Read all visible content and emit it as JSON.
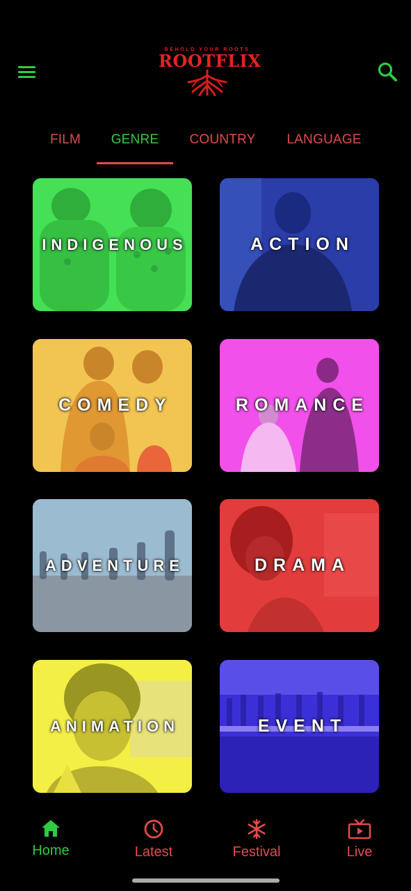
{
  "app": {
    "brand": "ROOTFLIX",
    "tagline": "BEHOLD YOUR ROOTS"
  },
  "tabs": [
    {
      "label": "FILM",
      "active": false
    },
    {
      "label": "GENRE",
      "active": true
    },
    {
      "label": "COUNTRY",
      "active": false
    },
    {
      "label": "LANGUAGE",
      "active": false
    }
  ],
  "genres": [
    {
      "label": "INDIGENOUS",
      "color": "#3fe34f"
    },
    {
      "label": "ACTION",
      "color": "#2438a6"
    },
    {
      "label": "COMEDY",
      "color": "#f0c04a"
    },
    {
      "label": "ROMANCE",
      "color": "#f04be6"
    },
    {
      "label": "ADVENTURE",
      "color": "#8fb3c8"
    },
    {
      "label": "DRAMA",
      "color": "#e03a3a"
    },
    {
      "label": "ANIMATION",
      "color": "#f2ee3a"
    },
    {
      "label": "EVENT",
      "color": "#3a2fd6"
    }
  ],
  "bottom_nav": [
    {
      "label": "Home",
      "icon": "home-icon",
      "active": true
    },
    {
      "label": "Latest",
      "icon": "clock-icon",
      "active": false
    },
    {
      "label": "Festival",
      "icon": "snowflake-icon",
      "active": false
    },
    {
      "label": "Live",
      "icon": "tv-play-icon",
      "active": false
    }
  ],
  "colors": {
    "accent_green": "#2ecc40",
    "accent_red": "#e34b4b",
    "background": "#000000"
  }
}
